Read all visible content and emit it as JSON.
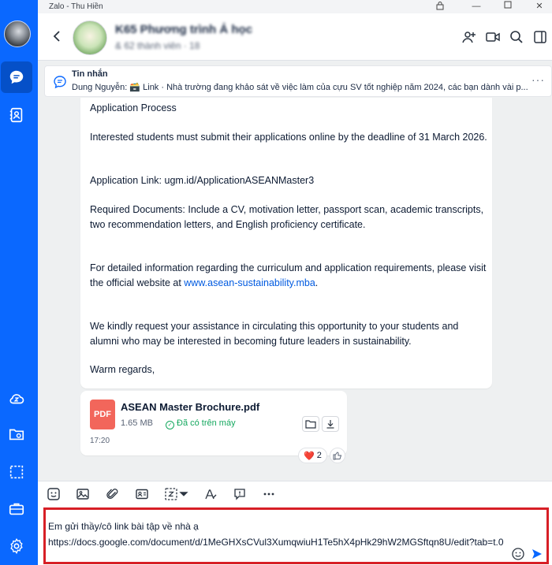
{
  "titlebar": {
    "app_title": "Zalo - Thu Hiền"
  },
  "chat": {
    "group_name": "K65 Phương trình Ả học",
    "group_sub": "& 62 thành viên · 18"
  },
  "pinned": {
    "title": "Tin nhắn",
    "text": "Dung Nguyễn: 🗃️ Link · Nhà trường đang khảo sát về việc làm của cựu SV tốt nghiệp năm 2024, các bạn dành vài p..."
  },
  "message": {
    "heading": "Application Process",
    "deadline": "Interested students must submit their applications online by the deadline of 31 March 2026.",
    "link_line": "Application Link: ugm.id/ApplicationASEANMaster3",
    "documents": "Required Documents: Include a CV, motivation letter, passport scan, academic transcripts, two recommendation letters, and English proficiency certificate.",
    "info_prefix": "For detailed information regarding the curriculum and application requirements, please visit the official website at ",
    "info_link": "www.asean-sustainability.mba",
    "info_suffix": ".",
    "request": "We kindly request your assistance in circulating this opportunity to your students and alumni who may be interested in becoming future leaders in sustainability.",
    "closing": "Warm regards,"
  },
  "file": {
    "badge": "PDF",
    "name": "ASEAN Master Brochure.pdf",
    "size": "1.65 MB",
    "status": "Đã có trên máy",
    "time": "17:20"
  },
  "reaction": {
    "emoji": "❤️",
    "count": "2"
  },
  "composer": {
    "line1": "Em gửi thầy/cô link bài tập về nhà ạ",
    "line2": "https://docs.google.com/document/d/1MeGHXsCVul3XumqwiuH1Te5hX4pHk29hW2MGSftqn8U/edit?tab=t.0"
  },
  "colors": {
    "nav_blue": "#0a68ff",
    "link_blue": "#005ae0",
    "highlight_red": "#d71f26",
    "status_green": "#15a85f",
    "pdf_red": "#f2665b"
  },
  "icons": {
    "nav": [
      "chat-icon",
      "contacts-icon",
      "cloud-icon",
      "folder-icon",
      "screenshot-icon",
      "briefcase-icon",
      "settings-icon"
    ],
    "header": [
      "add-member-icon",
      "video-call-icon",
      "search-icon",
      "sidebar-toggle-icon"
    ],
    "toolbar": [
      "sticker-icon",
      "image-icon",
      "attachment-icon",
      "contact-card-icon",
      "capture-icon",
      "format-text-icon",
      "quick-message-icon",
      "more-icon"
    ]
  }
}
